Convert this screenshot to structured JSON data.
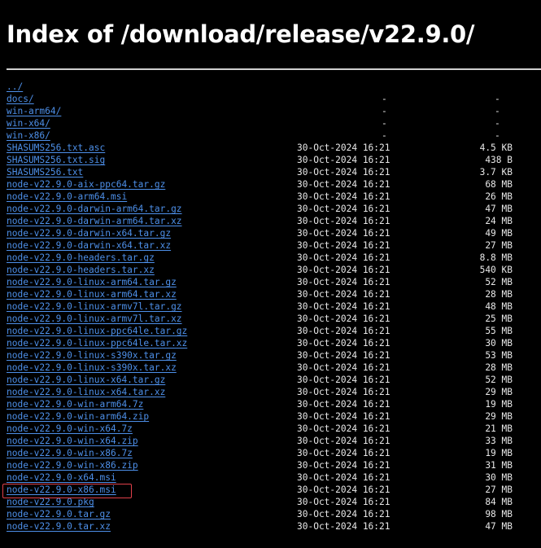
{
  "title": "Index of /download/release/v22.9.0/",
  "colors": {
    "background": "#000000",
    "link": "#4d8fe8",
    "text": "#e8e8e8",
    "highlight_box": "#e0404a"
  },
  "entries": [
    {
      "name": "../",
      "date": "",
      "size": ""
    },
    {
      "name": "docs/",
      "date": "-",
      "size": "-"
    },
    {
      "name": "win-arm64/",
      "date": "-",
      "size": "-"
    },
    {
      "name": "win-x64/",
      "date": "-",
      "size": "-"
    },
    {
      "name": "win-x86/",
      "date": "-",
      "size": "-"
    },
    {
      "name": "SHASUMS256.txt.asc",
      "date": "30-Oct-2024 16:21",
      "size": "4.5 KB"
    },
    {
      "name": "SHASUMS256.txt.sig",
      "date": "30-Oct-2024 16:21",
      "size": "438 B"
    },
    {
      "name": "SHASUMS256.txt",
      "date": "30-Oct-2024 16:21",
      "size": "3.7 KB"
    },
    {
      "name": "node-v22.9.0-aix-ppc64.tar.gz",
      "date": "30-Oct-2024 16:21",
      "size": "68 MB"
    },
    {
      "name": "node-v22.9.0-arm64.msi",
      "date": "30-Oct-2024 16:21",
      "size": "26 MB"
    },
    {
      "name": "node-v22.9.0-darwin-arm64.tar.gz",
      "date": "30-Oct-2024 16:21",
      "size": "47 MB"
    },
    {
      "name": "node-v22.9.0-darwin-arm64.tar.xz",
      "date": "30-Oct-2024 16:21",
      "size": "24 MB"
    },
    {
      "name": "node-v22.9.0-darwin-x64.tar.gz",
      "date": "30-Oct-2024 16:21",
      "size": "49 MB"
    },
    {
      "name": "node-v22.9.0-darwin-x64.tar.xz",
      "date": "30-Oct-2024 16:21",
      "size": "27 MB"
    },
    {
      "name": "node-v22.9.0-headers.tar.gz",
      "date": "30-Oct-2024 16:21",
      "size": "8.8 MB"
    },
    {
      "name": "node-v22.9.0-headers.tar.xz",
      "date": "30-Oct-2024 16:21",
      "size": "540 KB"
    },
    {
      "name": "node-v22.9.0-linux-arm64.tar.gz",
      "date": "30-Oct-2024 16:21",
      "size": "52 MB"
    },
    {
      "name": "node-v22.9.0-linux-arm64.tar.xz",
      "date": "30-Oct-2024 16:21",
      "size": "28 MB"
    },
    {
      "name": "node-v22.9.0-linux-armv7l.tar.gz",
      "date": "30-Oct-2024 16:21",
      "size": "48 MB"
    },
    {
      "name": "node-v22.9.0-linux-armv7l.tar.xz",
      "date": "30-Oct-2024 16:21",
      "size": "25 MB"
    },
    {
      "name": "node-v22.9.0-linux-ppc64le.tar.gz",
      "date": "30-Oct-2024 16:21",
      "size": "55 MB"
    },
    {
      "name": "node-v22.9.0-linux-ppc64le.tar.xz",
      "date": "30-Oct-2024 16:21",
      "size": "30 MB"
    },
    {
      "name": "node-v22.9.0-linux-s390x.tar.gz",
      "date": "30-Oct-2024 16:21",
      "size": "53 MB"
    },
    {
      "name": "node-v22.9.0-linux-s390x.tar.xz",
      "date": "30-Oct-2024 16:21",
      "size": "28 MB"
    },
    {
      "name": "node-v22.9.0-linux-x64.tar.gz",
      "date": "30-Oct-2024 16:21",
      "size": "52 MB"
    },
    {
      "name": "node-v22.9.0-linux-x64.tar.xz",
      "date": "30-Oct-2024 16:21",
      "size": "29 MB"
    },
    {
      "name": "node-v22.9.0-win-arm64.7z",
      "date": "30-Oct-2024 16:21",
      "size": "19 MB"
    },
    {
      "name": "node-v22.9.0-win-arm64.zip",
      "date": "30-Oct-2024 16:21",
      "size": "29 MB"
    },
    {
      "name": "node-v22.9.0-win-x64.7z",
      "date": "30-Oct-2024 16:21",
      "size": "21 MB"
    },
    {
      "name": "node-v22.9.0-win-x64.zip",
      "date": "30-Oct-2024 16:21",
      "size": "33 MB"
    },
    {
      "name": "node-v22.9.0-win-x86.7z",
      "date": "30-Oct-2024 16:21",
      "size": "19 MB"
    },
    {
      "name": "node-v22.9.0-win-x86.zip",
      "date": "30-Oct-2024 16:21",
      "size": "31 MB"
    },
    {
      "name": "node-v22.9.0-x64.msi",
      "date": "30-Oct-2024 16:21",
      "size": "30 MB"
    },
    {
      "name": "node-v22.9.0-x86.msi",
      "date": "30-Oct-2024 16:21",
      "size": "27 MB"
    },
    {
      "name": "node-v22.9.0.pkg",
      "date": "30-Oct-2024 16:21",
      "size": "84 MB"
    },
    {
      "name": "node-v22.9.0.tar.gz",
      "date": "30-Oct-2024 16:21",
      "size": "98 MB"
    },
    {
      "name": "node-v22.9.0.tar.xz",
      "date": "30-Oct-2024 16:21",
      "size": "47 MB"
    }
  ]
}
